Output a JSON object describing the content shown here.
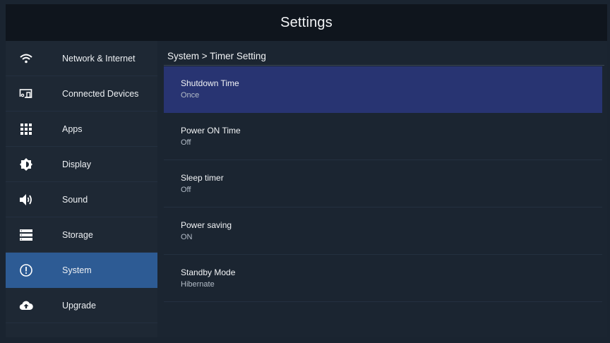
{
  "header": {
    "title": "Settings"
  },
  "sidebar": {
    "items": [
      {
        "label": "Network & Internet",
        "icon": "wifi-icon"
      },
      {
        "label": "Connected Devices",
        "icon": "devices-icon"
      },
      {
        "label": "Apps",
        "icon": "apps-grid-icon"
      },
      {
        "label": "Display",
        "icon": "brightness-icon"
      },
      {
        "label": "Sound",
        "icon": "speaker-icon"
      },
      {
        "label": "Storage",
        "icon": "storage-icon"
      },
      {
        "label": "System",
        "icon": "info-circle-icon",
        "selected": true
      },
      {
        "label": "Upgrade",
        "icon": "cloud-upload-icon"
      }
    ]
  },
  "main": {
    "breadcrumb": "System > Timer Setting",
    "options": [
      {
        "name": "Shutdown Time",
        "value": "Once",
        "selected": true
      },
      {
        "name": "Power ON Time",
        "value": "Off"
      },
      {
        "name": "Sleep timer",
        "value": "Off"
      },
      {
        "name": "Power saving",
        "value": "ON"
      },
      {
        "name": "Standby Mode",
        "value": "Hibernate"
      }
    ]
  },
  "colors": {
    "header_bg": "#0f151d",
    "sidebar_bg": "#1e2834",
    "sidebar_selected": "#2d5b94",
    "option_selected": "#283472"
  }
}
